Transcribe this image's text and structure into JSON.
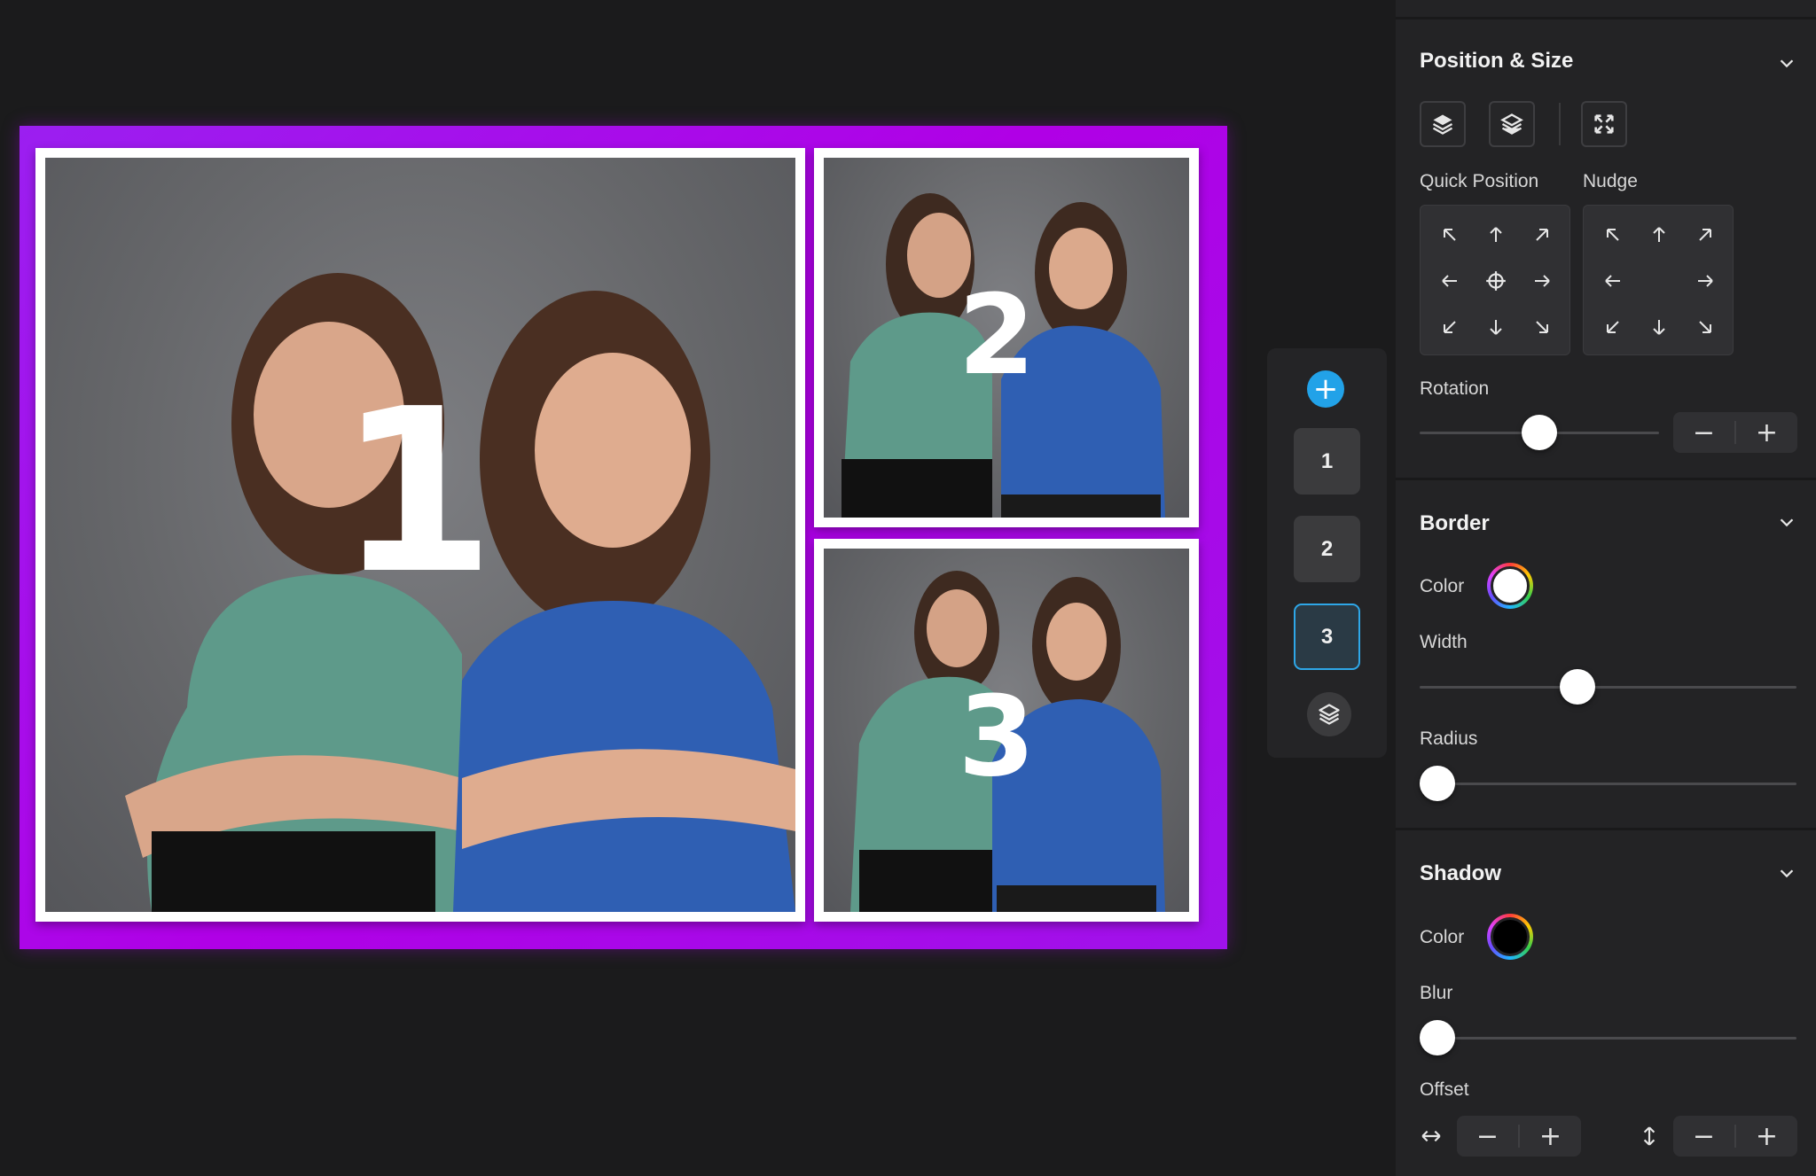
{
  "canvas": {
    "slots": [
      {
        "number": "1"
      },
      {
        "number": "2"
      },
      {
        "number": "3"
      }
    ],
    "colors": {
      "collage_background": "#a814ec",
      "border": "#ffffff"
    }
  },
  "slot_strip": {
    "add_label": "+",
    "slots": [
      "1",
      "2",
      "3"
    ],
    "active_slot": "3"
  },
  "panel": {
    "position_size": {
      "title": "Position & Size",
      "quick_position_label": "Quick Position",
      "nudge_label": "Nudge",
      "rotation_label": "Rotation",
      "rotation_value": 0.5,
      "minus": "−",
      "plus": "+"
    },
    "border": {
      "title": "Border",
      "color_label": "Color",
      "color": "#ffffff",
      "width_label": "Width",
      "width_value": 0.39,
      "radius_label": "Radius",
      "radius_value": 0.0
    },
    "shadow": {
      "title": "Shadow",
      "color_label": "Color",
      "color": "#000000",
      "blur_label": "Blur",
      "blur_value": 0.0,
      "offset_label": "Offset",
      "minus": "−",
      "plus": "+"
    }
  }
}
